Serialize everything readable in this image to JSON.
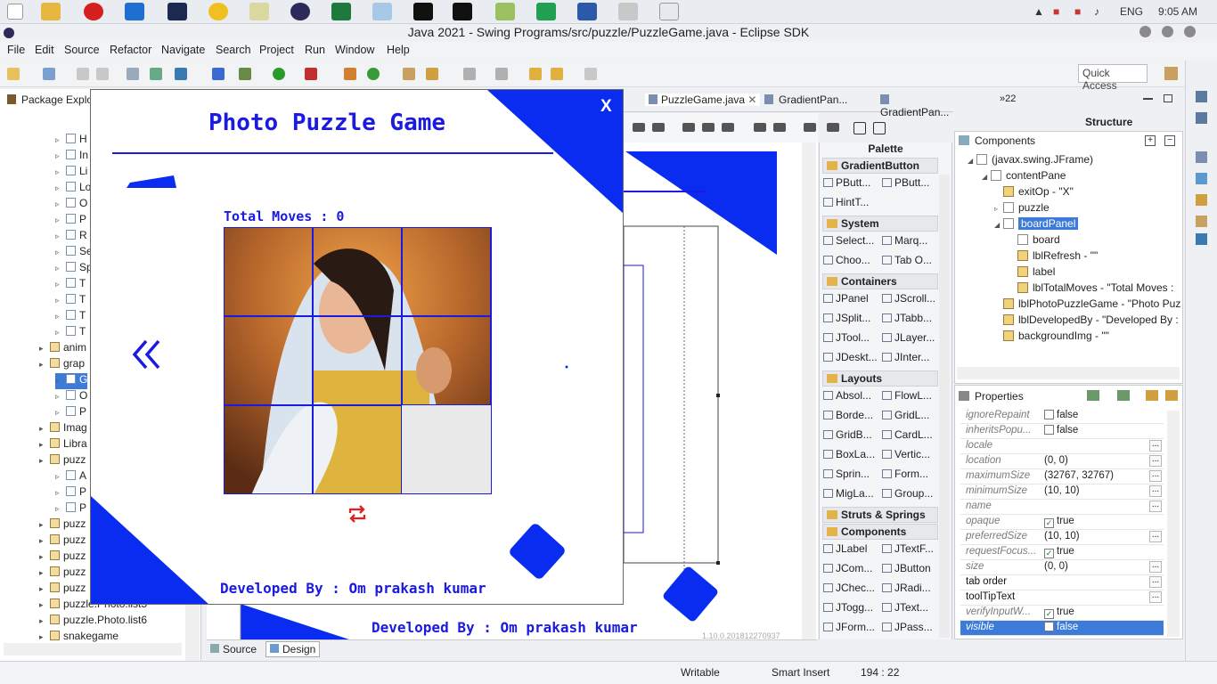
{
  "taskbar": {
    "lang": "ENG",
    "time": "9:05 AM"
  },
  "window": {
    "title": "Java 2021 - Swing Programs/src/puzzle/PuzzleGame.java - Eclipse SDK"
  },
  "menu": [
    "File",
    "Edit",
    "Source",
    "Refactor",
    "Navigate",
    "Search",
    "Project",
    "Run",
    "Window",
    "Help"
  ],
  "toolbar": {
    "quick_access": "Quick Access"
  },
  "package_explorer": {
    "title": "Package Explo",
    "rows": [
      {
        "label": "H",
        "indent": 62,
        "type": "file"
      },
      {
        "label": "In",
        "indent": 62,
        "type": "file"
      },
      {
        "label": "Li",
        "indent": 62,
        "type": "file"
      },
      {
        "label": "Lo",
        "indent": 62,
        "type": "file"
      },
      {
        "label": "O",
        "indent": 62,
        "type": "file"
      },
      {
        "label": "P",
        "indent": 62,
        "type": "file"
      },
      {
        "label": "R",
        "indent": 62,
        "type": "file"
      },
      {
        "label": "Se",
        "indent": 62,
        "type": "file"
      },
      {
        "label": "Sp",
        "indent": 62,
        "type": "file"
      },
      {
        "label": "T",
        "indent": 62,
        "type": "file"
      },
      {
        "label": "T",
        "indent": 62,
        "type": "file"
      },
      {
        "label": "T",
        "indent": 62,
        "type": "file"
      },
      {
        "label": "T",
        "indent": 62,
        "type": "file"
      },
      {
        "label": "anim",
        "indent": 44,
        "type": "pkg"
      },
      {
        "label": "grap",
        "indent": 44,
        "type": "pkg"
      },
      {
        "label": "G",
        "indent": 62,
        "type": "file",
        "selected": true
      },
      {
        "label": "O",
        "indent": 62,
        "type": "file"
      },
      {
        "label": "P",
        "indent": 62,
        "type": "file"
      },
      {
        "label": "Imag",
        "indent": 44,
        "type": "pkg"
      },
      {
        "label": "Libra",
        "indent": 44,
        "type": "pkg"
      },
      {
        "label": "puzz",
        "indent": 44,
        "type": "pkg"
      },
      {
        "label": "A",
        "indent": 62,
        "type": "file"
      },
      {
        "label": "P",
        "indent": 62,
        "type": "file"
      },
      {
        "label": "P",
        "indent": 62,
        "type": "file"
      },
      {
        "label": "puzz",
        "indent": 44,
        "type": "pkg"
      },
      {
        "label": "puzz",
        "indent": 44,
        "type": "pkg"
      },
      {
        "label": "puzz",
        "indent": 44,
        "type": "pkg"
      },
      {
        "label": "puzz",
        "indent": 44,
        "type": "pkg"
      },
      {
        "label": "puzz",
        "indent": 44,
        "type": "pkg"
      },
      {
        "label": "puzzle.Photo.list5",
        "indent": 44,
        "type": "pkg"
      },
      {
        "label": "puzzle.Photo.list6",
        "indent": 44,
        "type": "pkg"
      },
      {
        "label": "snakegame",
        "indent": 44,
        "type": "pkg"
      }
    ]
  },
  "editor_tabs": [
    {
      "label": "PuzzleGame.java",
      "active": true
    },
    {
      "label": "GradientPan..."
    },
    {
      "label": "GradientPan..."
    },
    {
      "label": "»22"
    }
  ],
  "bottom_tabs": {
    "source": "Source",
    "design": "Design"
  },
  "canvas": {
    "developed_by": "Developed By : Om prakash kumar",
    "version": "1.10.0.201812270937"
  },
  "palette": {
    "title": "Palette",
    "groups": [
      {
        "name": "GradientButton",
        "items": [
          "PButt...",
          "PButt...",
          "HintT..."
        ]
      },
      {
        "name": "System",
        "items": [
          "Select...",
          "Marq...",
          "Choo...",
          "Tab O..."
        ]
      },
      {
        "name": "Containers",
        "items": [
          "JPanel",
          "JScroll...",
          "JSplit...",
          "JTabb...",
          "JTool...",
          "JLayer...",
          "JDeskt...",
          "JInter..."
        ]
      },
      {
        "name": "Layouts",
        "items": [
          "Absol...",
          "FlowL...",
          "Borde...",
          "GridL...",
          "GridB...",
          "CardL...",
          "BoxLa...",
          "Vertic...",
          "Sprin...",
          "Form...",
          "MigLa...",
          "Group..."
        ]
      },
      {
        "name": "Struts & Springs",
        "items": []
      },
      {
        "name": "Components",
        "items": [
          "JLabel",
          "JTextF...",
          "JCom...",
          "JButton",
          "JChec...",
          "JRadi...",
          "JTogg...",
          "JText...",
          "JForm...",
          "JPass..."
        ]
      }
    ]
  },
  "structure": {
    "title": "Structure",
    "components_label": "Components",
    "tree": [
      {
        "label": "(javax.swing.JFrame)",
        "indent": 0,
        "icon": "box"
      },
      {
        "label": "contentPane",
        "indent": 16,
        "icon": "box"
      },
      {
        "label": "exitOp - \"X\"",
        "indent": 30,
        "icon": "label"
      },
      {
        "label": "puzzle",
        "indent": 30,
        "icon": "box"
      },
      {
        "label": "boardPanel",
        "indent": 30,
        "icon": "box",
        "selected": true
      },
      {
        "label": "board",
        "indent": 46,
        "icon": "box"
      },
      {
        "label": "lblRefresh - \"\"",
        "indent": 46,
        "icon": "label"
      },
      {
        "label": "label",
        "indent": 46,
        "icon": "label"
      },
      {
        "label": "lblTotalMoves - \"Total Moves :",
        "indent": 46,
        "icon": "label"
      },
      {
        "label": "lblPhotoPuzzleGame - \"Photo Puz",
        "indent": 30,
        "icon": "label"
      },
      {
        "label": "lblDevelopedBy - \"Developed By :",
        "indent": 30,
        "icon": "label"
      },
      {
        "label": "backgroundImg - \"\"",
        "indent": 30,
        "icon": "label"
      }
    ]
  },
  "properties": {
    "title": "Properties",
    "rows": [
      {
        "name": "ignoreRepaint",
        "value": "false",
        "check": "off"
      },
      {
        "name": "inheritsPopu...",
        "value": "false",
        "check": "off"
      },
      {
        "name": "locale",
        "value": "",
        "dots": true
      },
      {
        "name": "location",
        "value": "(0, 0)",
        "dots": true
      },
      {
        "name": "maximumSize",
        "value": "(32767, 32767)",
        "dots": true
      },
      {
        "name": "minimumSize",
        "value": "(10, 10)",
        "dots": true
      },
      {
        "name": "name",
        "value": "",
        "dots": true
      },
      {
        "name": "opaque",
        "value": "true",
        "check": "on"
      },
      {
        "name": "preferredSize",
        "value": "(10, 10)",
        "dots": true
      },
      {
        "name": "requestFocus...",
        "value": "true",
        "check": "on"
      },
      {
        "name": "size",
        "value": "(0, 0)",
        "dots": true
      },
      {
        "name": "tab order",
        "value": "",
        "dots": true,
        "bold": true
      },
      {
        "name": "toolTipText",
        "value": "",
        "dots": true,
        "bold": true
      },
      {
        "name": "verifyInputW...",
        "value": "true",
        "check": "on"
      },
      {
        "name": "visible",
        "value": "false",
        "check": "off",
        "selected": true
      }
    ]
  },
  "status": {
    "writable": "Writable",
    "insert": "Smart Insert",
    "position": "194 : 22"
  },
  "game": {
    "title": "Photo Puzzle Game",
    "exit": "X",
    "total_moves": "Total Moves : 0",
    "developed_by": "Developed By : Om prakash kumar",
    "back_icon": "double-chevron-left-icon",
    "refresh_icon": "refresh-icon"
  },
  "colors": {
    "game_blue": "#1a1ae0",
    "accent_blue": "#0a2cf0",
    "refresh_red": "#e02020",
    "selection": "#3d7bd9"
  }
}
